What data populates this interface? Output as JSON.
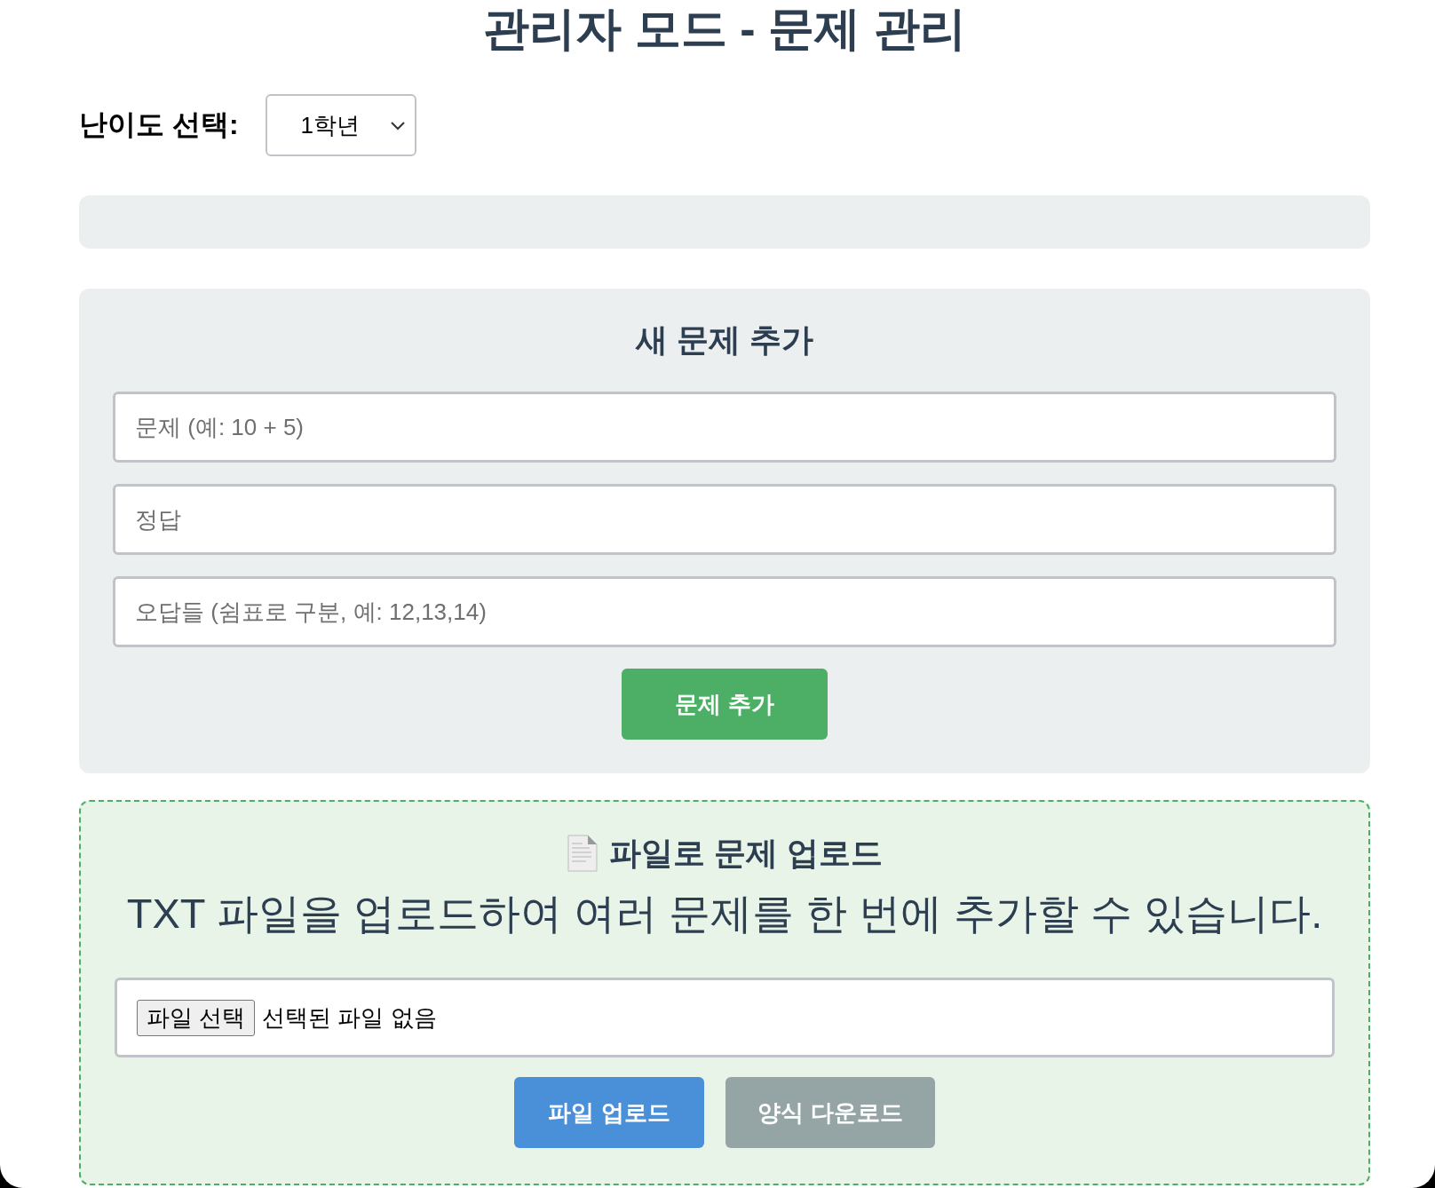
{
  "title": "관리자 모드 - 문제 관리",
  "difficulty": {
    "label": "난이도 선택:",
    "value": "1학년"
  },
  "add_panel": {
    "heading": "새 문제 추가",
    "fields": [
      {
        "placeholder": "문제 (예: 10 + 5)"
      },
      {
        "placeholder": "정답"
      },
      {
        "placeholder": "오답들 (쉼표로 구분, 예: 12,13,14)"
      }
    ],
    "button": "문제 추가"
  },
  "upload_panel": {
    "heading": "파일로 문제 업로드",
    "description": "TXT 파일을 업로드하여 여러 문제를 한 번에 추가할 수 있습니다.",
    "file_button": "파일 선택",
    "file_status": "선택된 파일 없음",
    "buttons": [
      {
        "label": "파일 업로드",
        "kind": "primary"
      },
      {
        "label": "양식 다운로드",
        "kind": "secondary"
      }
    ]
  }
}
